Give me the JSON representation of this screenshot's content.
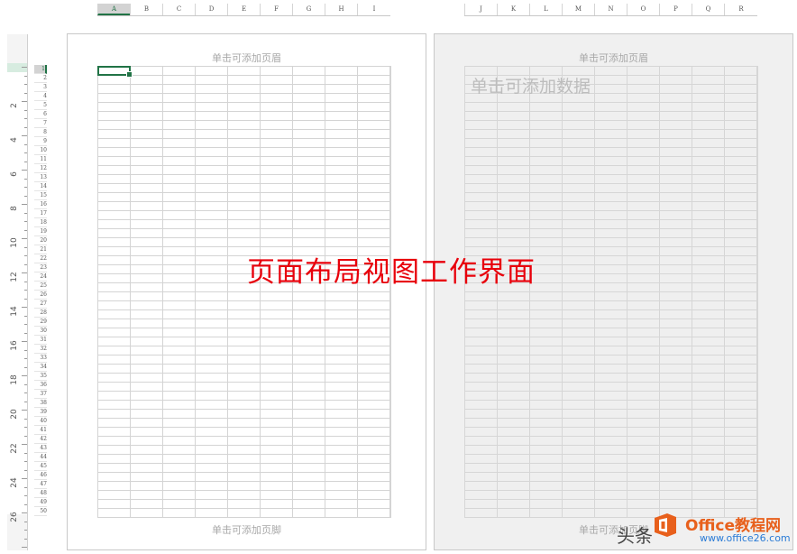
{
  "columns_page1": [
    "A",
    "B",
    "C",
    "D",
    "E",
    "F",
    "G",
    "H",
    "I"
  ],
  "columns_page2": [
    "J",
    "K",
    "L",
    "M",
    "N",
    "O",
    "P",
    "Q",
    "R"
  ],
  "selected_column": "A",
  "ruler_numbers": [
    "2",
    "4",
    "6",
    "8",
    "10",
    "12",
    "14",
    "16",
    "18",
    "20",
    "22",
    "24",
    "26"
  ],
  "row_numbers": [
    "1",
    "2",
    "3",
    "4",
    "5",
    "6",
    "7",
    "8",
    "9",
    "10",
    "11",
    "12",
    "13",
    "14",
    "15",
    "16",
    "17",
    "18",
    "19",
    "20",
    "21",
    "22",
    "23",
    "24",
    "25",
    "26",
    "27",
    "28",
    "29",
    "30",
    "31",
    "32",
    "33",
    "34",
    "35",
    "36",
    "37",
    "38",
    "39",
    "40",
    "41",
    "42",
    "43",
    "44",
    "45",
    "46",
    "47",
    "48",
    "49",
    "50"
  ],
  "selected_row": "1",
  "page1": {
    "header_placeholder": "单击可添加页眉",
    "footer_placeholder": "单击可添加页脚"
  },
  "page2": {
    "header_placeholder": "单击可添加页眉",
    "data_placeholder": "单击可添加数据",
    "footer_placeholder": "单击可添加页脚"
  },
  "overlay_title": "页面布局视图工作界面",
  "watermark": {
    "source": "头条",
    "brand": "Office教程网",
    "url": "www.office26.com"
  },
  "colors": {
    "accent_green": "#217346",
    "overlay_red": "#e8000b",
    "brand_orange": "#e8601c"
  }
}
